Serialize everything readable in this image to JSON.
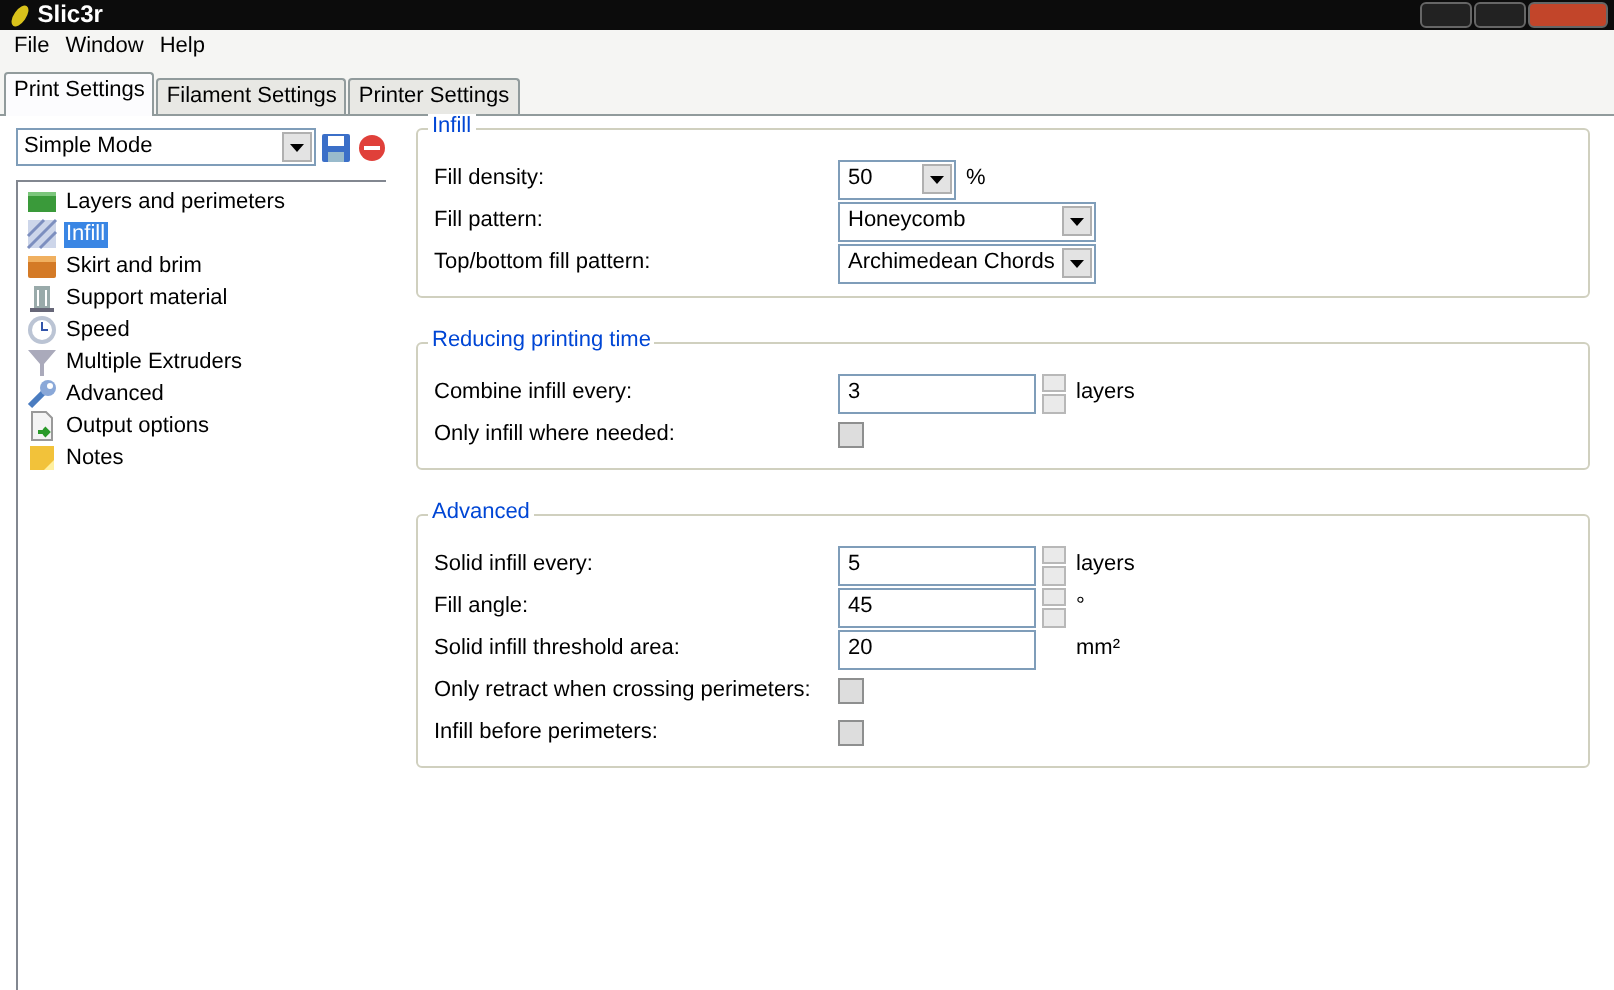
{
  "window": {
    "title": "Slic3r"
  },
  "menu": [
    "File",
    "Window",
    "Help"
  ],
  "tabs": [
    {
      "label": "Print Settings",
      "selected": true
    },
    {
      "label": "Filament Settings",
      "selected": false
    },
    {
      "label": "Printer Settings",
      "selected": false
    }
  ],
  "preset": {
    "value": "Simple Mode"
  },
  "sidebar": {
    "items": [
      {
        "label": "Layers and perimeters",
        "selected": false
      },
      {
        "label": "Infill",
        "selected": true
      },
      {
        "label": "Skirt and brim",
        "selected": false
      },
      {
        "label": "Support material",
        "selected": false
      },
      {
        "label": "Speed",
        "selected": false
      },
      {
        "label": "Multiple Extruders",
        "selected": false
      },
      {
        "label": "Advanced",
        "selected": false
      },
      {
        "label": "Output options",
        "selected": false
      },
      {
        "label": "Notes",
        "selected": false
      }
    ]
  },
  "groups": [
    {
      "title": "Infill",
      "options": [
        {
          "kind": "combo",
          "label": "Fill density:",
          "value": "50",
          "unit": "%"
        },
        {
          "kind": "combo",
          "label": "Fill pattern:",
          "value": "Honeycomb"
        },
        {
          "kind": "combo",
          "label": "Top/bottom fill pattern:",
          "value": "Archimedean Chords"
        }
      ]
    },
    {
      "title": "Reducing printing time",
      "options": [
        {
          "kind": "spin",
          "label": "Combine infill every:",
          "value": "3",
          "unit": "layers"
        },
        {
          "kind": "checkbox",
          "label": "Only infill where needed:",
          "checked": false
        }
      ]
    },
    {
      "title": "Advanced",
      "options": [
        {
          "kind": "spin",
          "label": "Solid infill every:",
          "value": "5",
          "unit": "layers"
        },
        {
          "kind": "spin",
          "label": "Fill angle:",
          "value": "45",
          "unit": "°"
        },
        {
          "kind": "text",
          "label": "Solid infill threshold area:",
          "value": "20",
          "unit": "mm²"
        },
        {
          "kind": "checkbox",
          "label": "Only retract when crossing perimeters:",
          "checked": false
        },
        {
          "kind": "checkbox",
          "label": "Infill before perimeters:",
          "checked": false
        }
      ]
    }
  ]
}
